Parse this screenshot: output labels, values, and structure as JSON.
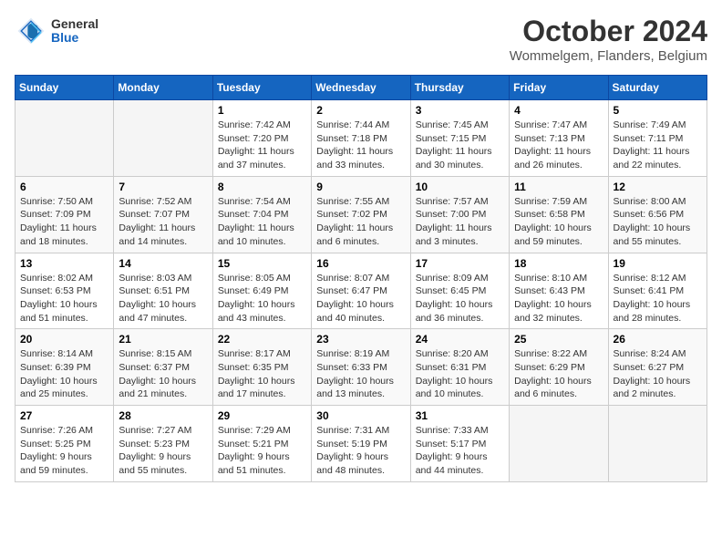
{
  "header": {
    "logo_general": "General",
    "logo_blue": "Blue",
    "title": "October 2024",
    "subtitle": "Wommelgem, Flanders, Belgium"
  },
  "calendar": {
    "days_of_week": [
      "Sunday",
      "Monday",
      "Tuesday",
      "Wednesday",
      "Thursday",
      "Friday",
      "Saturday"
    ],
    "weeks": [
      [
        {
          "day": "",
          "info": ""
        },
        {
          "day": "",
          "info": ""
        },
        {
          "day": "1",
          "info": "Sunrise: 7:42 AM\nSunset: 7:20 PM\nDaylight: 11 hours and 37 minutes."
        },
        {
          "day": "2",
          "info": "Sunrise: 7:44 AM\nSunset: 7:18 PM\nDaylight: 11 hours and 33 minutes."
        },
        {
          "day": "3",
          "info": "Sunrise: 7:45 AM\nSunset: 7:15 PM\nDaylight: 11 hours and 30 minutes."
        },
        {
          "day": "4",
          "info": "Sunrise: 7:47 AM\nSunset: 7:13 PM\nDaylight: 11 hours and 26 minutes."
        },
        {
          "day": "5",
          "info": "Sunrise: 7:49 AM\nSunset: 7:11 PM\nDaylight: 11 hours and 22 minutes."
        }
      ],
      [
        {
          "day": "6",
          "info": "Sunrise: 7:50 AM\nSunset: 7:09 PM\nDaylight: 11 hours and 18 minutes."
        },
        {
          "day": "7",
          "info": "Sunrise: 7:52 AM\nSunset: 7:07 PM\nDaylight: 11 hours and 14 minutes."
        },
        {
          "day": "8",
          "info": "Sunrise: 7:54 AM\nSunset: 7:04 PM\nDaylight: 11 hours and 10 minutes."
        },
        {
          "day": "9",
          "info": "Sunrise: 7:55 AM\nSunset: 7:02 PM\nDaylight: 11 hours and 6 minutes."
        },
        {
          "day": "10",
          "info": "Sunrise: 7:57 AM\nSunset: 7:00 PM\nDaylight: 11 hours and 3 minutes."
        },
        {
          "day": "11",
          "info": "Sunrise: 7:59 AM\nSunset: 6:58 PM\nDaylight: 10 hours and 59 minutes."
        },
        {
          "day": "12",
          "info": "Sunrise: 8:00 AM\nSunset: 6:56 PM\nDaylight: 10 hours and 55 minutes."
        }
      ],
      [
        {
          "day": "13",
          "info": "Sunrise: 8:02 AM\nSunset: 6:53 PM\nDaylight: 10 hours and 51 minutes."
        },
        {
          "day": "14",
          "info": "Sunrise: 8:03 AM\nSunset: 6:51 PM\nDaylight: 10 hours and 47 minutes."
        },
        {
          "day": "15",
          "info": "Sunrise: 8:05 AM\nSunset: 6:49 PM\nDaylight: 10 hours and 43 minutes."
        },
        {
          "day": "16",
          "info": "Sunrise: 8:07 AM\nSunset: 6:47 PM\nDaylight: 10 hours and 40 minutes."
        },
        {
          "day": "17",
          "info": "Sunrise: 8:09 AM\nSunset: 6:45 PM\nDaylight: 10 hours and 36 minutes."
        },
        {
          "day": "18",
          "info": "Sunrise: 8:10 AM\nSunset: 6:43 PM\nDaylight: 10 hours and 32 minutes."
        },
        {
          "day": "19",
          "info": "Sunrise: 8:12 AM\nSunset: 6:41 PM\nDaylight: 10 hours and 28 minutes."
        }
      ],
      [
        {
          "day": "20",
          "info": "Sunrise: 8:14 AM\nSunset: 6:39 PM\nDaylight: 10 hours and 25 minutes."
        },
        {
          "day": "21",
          "info": "Sunrise: 8:15 AM\nSunset: 6:37 PM\nDaylight: 10 hours and 21 minutes."
        },
        {
          "day": "22",
          "info": "Sunrise: 8:17 AM\nSunset: 6:35 PM\nDaylight: 10 hours and 17 minutes."
        },
        {
          "day": "23",
          "info": "Sunrise: 8:19 AM\nSunset: 6:33 PM\nDaylight: 10 hours and 13 minutes."
        },
        {
          "day": "24",
          "info": "Sunrise: 8:20 AM\nSunset: 6:31 PM\nDaylight: 10 hours and 10 minutes."
        },
        {
          "day": "25",
          "info": "Sunrise: 8:22 AM\nSunset: 6:29 PM\nDaylight: 10 hours and 6 minutes."
        },
        {
          "day": "26",
          "info": "Sunrise: 8:24 AM\nSunset: 6:27 PM\nDaylight: 10 hours and 2 minutes."
        }
      ],
      [
        {
          "day": "27",
          "info": "Sunrise: 7:26 AM\nSunset: 5:25 PM\nDaylight: 9 hours and 59 minutes."
        },
        {
          "day": "28",
          "info": "Sunrise: 7:27 AM\nSunset: 5:23 PM\nDaylight: 9 hours and 55 minutes."
        },
        {
          "day": "29",
          "info": "Sunrise: 7:29 AM\nSunset: 5:21 PM\nDaylight: 9 hours and 51 minutes."
        },
        {
          "day": "30",
          "info": "Sunrise: 7:31 AM\nSunset: 5:19 PM\nDaylight: 9 hours and 48 minutes."
        },
        {
          "day": "31",
          "info": "Sunrise: 7:33 AM\nSunset: 5:17 PM\nDaylight: 9 hours and 44 minutes."
        },
        {
          "day": "",
          "info": ""
        },
        {
          "day": "",
          "info": ""
        }
      ]
    ]
  }
}
